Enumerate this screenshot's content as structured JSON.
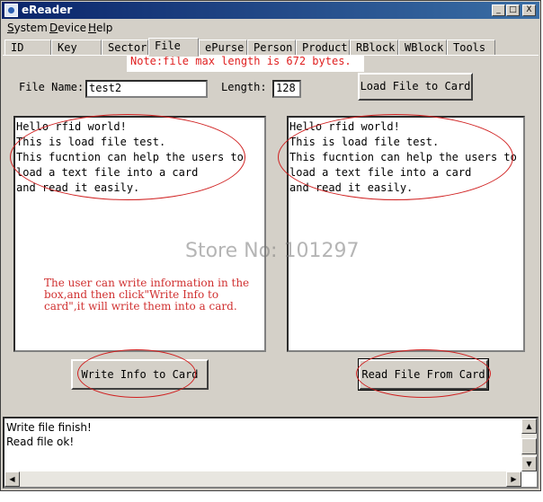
{
  "window": {
    "title": "eReader",
    "min": "_",
    "max": "□",
    "close": "X"
  },
  "menu": [
    "System",
    "Device",
    "Help"
  ],
  "tabs": [
    "ID",
    "Key",
    "Sector",
    "File",
    "ePurse",
    "Person",
    "Product",
    "RBlock",
    "WBlock",
    "Tools"
  ],
  "note": "Note:file max length is 672 bytes.",
  "form": {
    "file_name_label": "File Name:",
    "file_name_value": "test2",
    "length_label": "Length:",
    "length_value": "128",
    "load_button": "Load File to Card"
  },
  "left_text": "Hello rfid world!\nThis is load file test.\nThis fucntion can help the users to\nload a text file into a card\nand read it easily.",
  "right_text": "Hello rfid world!\nThis is load file test.\nThis fucntion can help the users to\nload a text file into a card\nand read it easily.",
  "hint": "The user can write information in the box,and then click\"Write Info to card\",it will write them into a card.",
  "watermark": "Store No: 101297",
  "buttons": {
    "write": "Write Info to Card",
    "read": "Read File From Card"
  },
  "log": [
    "Write file finish!",
    "Read file ok!"
  ],
  "colors": {
    "title_bar": "#0a246a",
    "window_face": "#d4d0c8",
    "annotation_red": "#d02020"
  }
}
